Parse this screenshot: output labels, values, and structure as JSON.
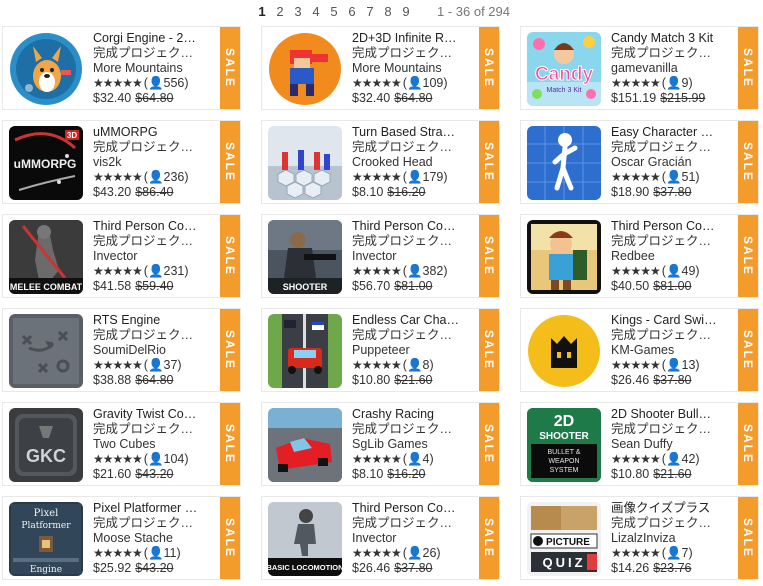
{
  "pagination": {
    "pages": [
      "1",
      "2",
      "3",
      "4",
      "5",
      "6",
      "7",
      "8",
      "9"
    ],
    "current": "1",
    "count_text": "1 - 36 of 294"
  },
  "sale_label": "SALE",
  "star_glyphs": "★★★★★",
  "user_glyph": "👤",
  "assets": [
    {
      "title": "Corgi Engine - 2…",
      "category": "完成プロジェクト…",
      "publisher": "More Mountains",
      "stars": "★★★★★",
      "reviews": "(👤556)",
      "price": "$32.40",
      "old_price": "$64.80",
      "icon": "corgi-thumbnail"
    },
    {
      "title": "2D+3D Infinite R…",
      "category": "完成プロジェクト…",
      "publisher": "More Mountains",
      "stars": "★★★★★",
      "reviews": "(👤109)",
      "price": "$32.40",
      "old_price": "$64.80",
      "icon": "runner-thumbnail"
    },
    {
      "title": "Candy Match 3 Kit",
      "category": "完成プロジェクト…",
      "publisher": "gamevanilla",
      "stars": "★★★★★",
      "reviews": "(👤9)",
      "price": "$151.19",
      "old_price": "$215.99",
      "icon": "candy-thumbnail"
    },
    {
      "title": "uMMORPG",
      "category": "完成プロジェクト…",
      "publisher": "vis2k",
      "stars": "★★★★★",
      "reviews": "(👤236)",
      "price": "$43.20",
      "old_price": "$86.40",
      "icon": "mmorpg-thumbnail"
    },
    {
      "title": "Turn Based Stra…",
      "category": "完成プロジェクト…",
      "publisher": "Crooked Head",
      "stars": "★★★★★",
      "reviews": "(👤179)",
      "price": "$8.10",
      "old_price": "$16.20",
      "icon": "hexgrid-thumbnail"
    },
    {
      "title": "Easy Character …",
      "category": "完成プロジェクト…",
      "publisher": "Oscar Gracián",
      "stars": "★★★★★",
      "reviews": "(👤51)",
      "price": "$18.90",
      "old_price": "$37.80",
      "icon": "character-thumbnail"
    },
    {
      "title": "Third Person Co…",
      "category": "完成プロジェクト…",
      "publisher": "Invector",
      "stars": "★★★★★",
      "reviews": "(👤231)",
      "price": "$41.58",
      "old_price": "$59.40",
      "icon": "melee-thumbnail"
    },
    {
      "title": "Third Person Co…",
      "category": "完成プロジェクト…",
      "publisher": "Invector",
      "stars": "★★★★★",
      "reviews": "(👤382)",
      "price": "$56.70",
      "old_price": "$81.00",
      "icon": "shooter-thumbnail"
    },
    {
      "title": "Third Person Co…",
      "category": "完成プロジェクト…",
      "publisher": "Redbee",
      "stars": "★★★★★",
      "reviews": "(👤49)",
      "price": "$40.50",
      "old_price": "$81.00",
      "icon": "cartoon-thumbnail"
    },
    {
      "title": "RTS Engine",
      "category": "完成プロジェクト…",
      "publisher": "SoumiDelRio",
      "stars": "★★★★★",
      "reviews": "(👤37)",
      "price": "$38.88",
      "old_price": "$64.80",
      "icon": "rts-thumbnail"
    },
    {
      "title": "Endless Car Cha…",
      "category": "完成プロジェクト…",
      "publisher": "Puppeteer",
      "stars": "★★★★★",
      "reviews": "(👤8)",
      "price": "$10.80",
      "old_price": "$21.60",
      "icon": "car-chase-thumbnail"
    },
    {
      "title": "Kings - Card Swi…",
      "category": "完成プロジェクト…",
      "publisher": "KM-Games",
      "stars": "★★★★★",
      "reviews": "(👤13)",
      "price": "$26.46",
      "old_price": "$37.80",
      "icon": "kings-thumbnail"
    },
    {
      "title": "Gravity Twist Co…",
      "category": "完成プロジェクト…",
      "publisher": "Two Cubes",
      "stars": "★★★★★",
      "reviews": "(👤104)",
      "price": "$21.60",
      "old_price": "$43.20",
      "icon": "gkc-thumbnail"
    },
    {
      "title": "Crashy Racing",
      "category": "完成プロジェクト…",
      "publisher": "SgLib Games",
      "stars": "★★★★★",
      "reviews": "(👤4)",
      "price": "$8.10",
      "old_price": "$16.20",
      "icon": "crashy-thumbnail"
    },
    {
      "title": "2D Shooter Bull…",
      "category": "完成プロジェクト…",
      "publisher": "Sean Duffy",
      "stars": "★★★★★",
      "reviews": "(👤42)",
      "price": "$10.80",
      "old_price": "$21.60",
      "icon": "bullet-thumbnail"
    },
    {
      "title": "Pixel Platformer …",
      "category": "完成プロジェクト…",
      "publisher": "Moose Stache",
      "stars": "★★★★★",
      "reviews": "(👤11)",
      "price": "$25.92",
      "old_price": "$43.20",
      "icon": "pixel-thumbnail"
    },
    {
      "title": "Third Person Co…",
      "category": "完成プロジェクト…",
      "publisher": "Invector",
      "stars": "★★★★★",
      "reviews": "(👤26)",
      "price": "$26.46",
      "old_price": "$37.80",
      "icon": "locomotion-thumbnail"
    },
    {
      "title": "画像クイズプラス",
      "category": "完成プロジェクト…",
      "publisher": "LizalzInviza",
      "stars": "★★★★★",
      "reviews": "(👤7)",
      "price": "$14.26",
      "old_price": "$23.76",
      "icon": "quiz-thumbnail"
    }
  ],
  "thumb_text": {
    "mmorpg_tag": "3D",
    "mmorpg_logo": "uMMORPG",
    "melee": "MELEE COMBAT",
    "shooter": "SHOOTER",
    "candy": "Candy",
    "candy_sub": "Match 3 Kit",
    "gkc": "GKC",
    "bullet_1": "2D",
    "bullet_2": "SHOOTER",
    "bullet_3": "BULLET &",
    "bullet_4": "WEAPON",
    "bullet_5": "SYSTEM",
    "pixel_1": "Pixel",
    "pixel_2": "Platformer",
    "pixel_3": "Engine",
    "locomotion": "BASIC LOCOMOTION",
    "quiz_1": "PICTURE",
    "quiz_2": "QUIZ"
  }
}
